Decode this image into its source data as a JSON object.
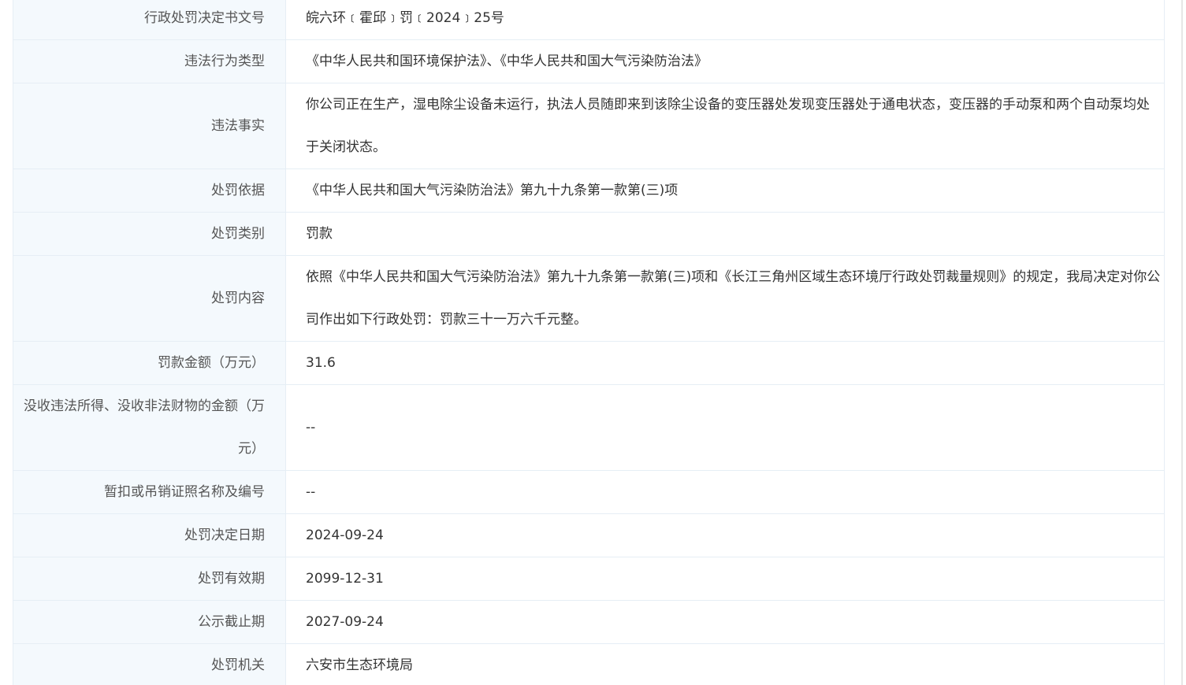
{
  "rows": [
    {
      "label": "行政处罚决定书文号",
      "value": "皖六环﹝霍邱﹞罚﹝2024﹞25号"
    },
    {
      "label": "违法行为类型",
      "value": "《中华人民共和国环境保护法》、《中华人民共和国大气污染防治法》"
    },
    {
      "label": "违法事实",
      "value": "你公司正在生产，湿电除尘设备未运行，执法人员随即来到该除尘设备的变压器处发现变压器处于通电状态，变压器的手动泵和两个自动泵均处于关闭状态。"
    },
    {
      "label": "处罚依据",
      "value": "《中华人民共和国大气污染防治法》第九十九条第一款第(三)项"
    },
    {
      "label": "处罚类别",
      "value": "罚款"
    },
    {
      "label": "处罚内容",
      "value": "依照《中华人民共和国大气污染防治法》第九十九条第一款第(三)项和《长江三角州区域生态环境厅行政处罚裁量规则》的规定，我局决定对你公司作出如下行政处罚：罚款三十一万六千元整。"
    },
    {
      "label": "罚款金额（万元）",
      "value": "31.6"
    },
    {
      "label": "没收违法所得、没收非法财物的金额（万元）",
      "value": "--"
    },
    {
      "label": "暂扣或吊销证照名称及编号",
      "value": "--"
    },
    {
      "label": "处罚决定日期",
      "value": "2024-09-24"
    },
    {
      "label": "处罚有效期",
      "value": "2099-12-31"
    },
    {
      "label": "公示截止期",
      "value": "2027-09-24"
    },
    {
      "label": "处罚机关",
      "value": "六安市生态环境局"
    }
  ]
}
